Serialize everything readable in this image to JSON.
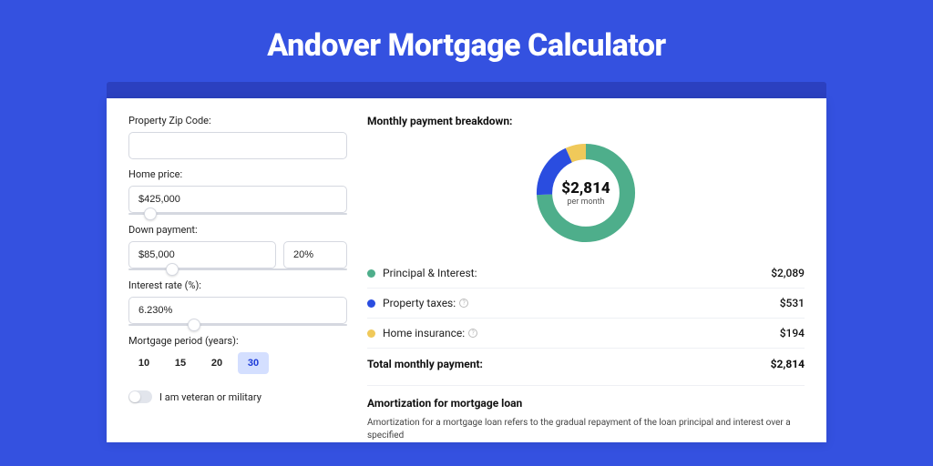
{
  "title": "Andover Mortgage Calculator",
  "form": {
    "zip_label": "Property Zip Code:",
    "zip_value": "",
    "price_label": "Home price:",
    "price_value": "$425,000",
    "price_slider_pct": 10,
    "down_label": "Down payment:",
    "down_value": "$85,000",
    "down_pct_value": "20%",
    "down_slider_pct": 20,
    "rate_label": "Interest rate (%):",
    "rate_value": "6.230%",
    "rate_slider_pct": 30,
    "period_label": "Mortgage period (years):",
    "period_options": [
      "10",
      "15",
      "20",
      "30"
    ],
    "period_selected_index": 3,
    "veteran_label": "I am veteran or military",
    "veteran_on": false
  },
  "breakdown": {
    "title": "Monthly payment breakdown:",
    "center_amount": "$2,814",
    "center_sub": "per month",
    "items": [
      {
        "label": "Principal & Interest:",
        "value": "$2,089",
        "color": "#4eae8b",
        "info": false
      },
      {
        "label": "Property taxes:",
        "value": "$531",
        "color": "#2a4de0",
        "info": true
      },
      {
        "label": "Home insurance:",
        "value": "$194",
        "color": "#f0c95a",
        "info": true
      }
    ],
    "total_label": "Total monthly payment:",
    "total_value": "$2,814"
  },
  "amort": {
    "title": "Amortization for mortgage loan",
    "text": "Amortization for a mortgage loan refers to the gradual repayment of the loan principal and interest over a specified"
  },
  "chart_data": {
    "type": "pie",
    "title": "Monthly payment breakdown",
    "series": [
      {
        "name": "Principal & Interest",
        "value": 2089,
        "color": "#4eae8b"
      },
      {
        "name": "Property taxes",
        "value": 531,
        "color": "#2a4de0"
      },
      {
        "name": "Home insurance",
        "value": 194,
        "color": "#f0c95a"
      }
    ],
    "total": 2814,
    "center_label": "$2,814 per month"
  }
}
